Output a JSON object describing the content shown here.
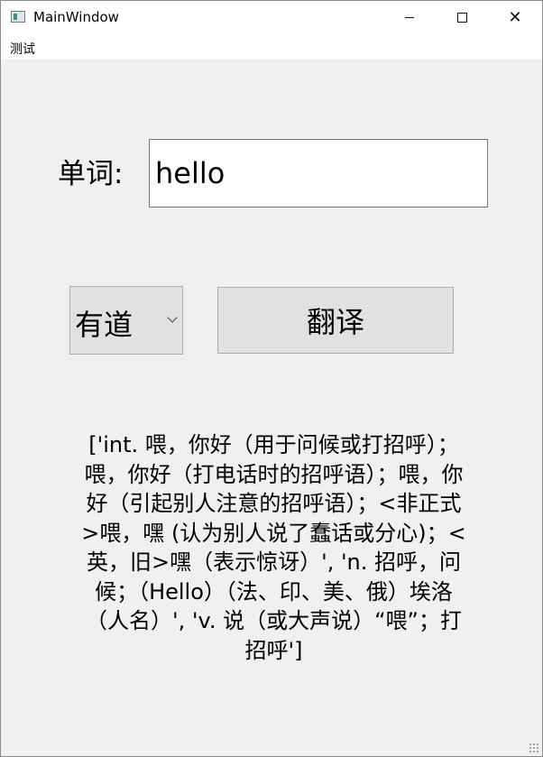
{
  "window": {
    "title": "MainWindow"
  },
  "menubar": {
    "items": [
      "测试"
    ]
  },
  "form": {
    "word_label": "单词:",
    "word_value": "hello",
    "engine_selected": "有道",
    "translate_label": "翻译"
  },
  "result": {
    "text": "['int. 喂，你好（用于问候或打招呼）；喂，你好（打电话时的招呼语）；喂，你好（引起别人注意的招呼语）；<非正式>喂，嘿 (认为别人说了蠢话或分心)；<英，旧>嘿（表示惊讶）', 'n. 招呼，问候；（Hello）（法、印、美、俄）埃洛（人名）', 'v. 说（或大声说）“喂”；打招呼']"
  }
}
